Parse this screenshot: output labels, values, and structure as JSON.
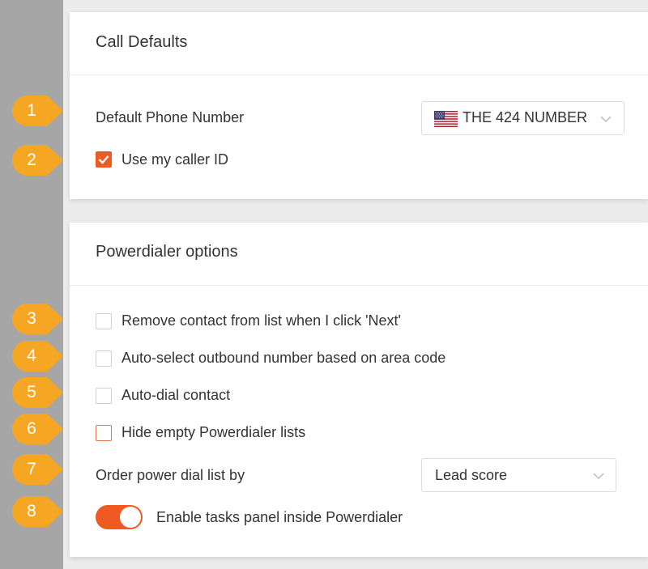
{
  "call_defaults": {
    "title": "Call Defaults",
    "default_phone_label": "Default Phone Number",
    "default_phone_value": "THE 424 NUMBER",
    "use_caller_id_label": "Use my caller ID",
    "use_caller_id_checked": true
  },
  "powerdialer": {
    "title": "Powerdialer options",
    "remove_contact_label": "Remove contact from list when I click 'Next'",
    "auto_select_label": "Auto-select outbound number based on area code",
    "auto_dial_label": "Auto-dial contact",
    "hide_empty_label": "Hide empty Powerdialer lists",
    "order_by_label": "Order power dial list by",
    "order_by_value": "Lead score",
    "enable_tasks_label": "Enable tasks panel inside Powerdialer",
    "enable_tasks_on": true
  },
  "callouts": [
    "1",
    "2",
    "3",
    "4",
    "5",
    "6",
    "7",
    "8"
  ],
  "colors": {
    "accent": "#f05a22",
    "callout": "#f5a623",
    "rail": "#a6a6a6"
  }
}
